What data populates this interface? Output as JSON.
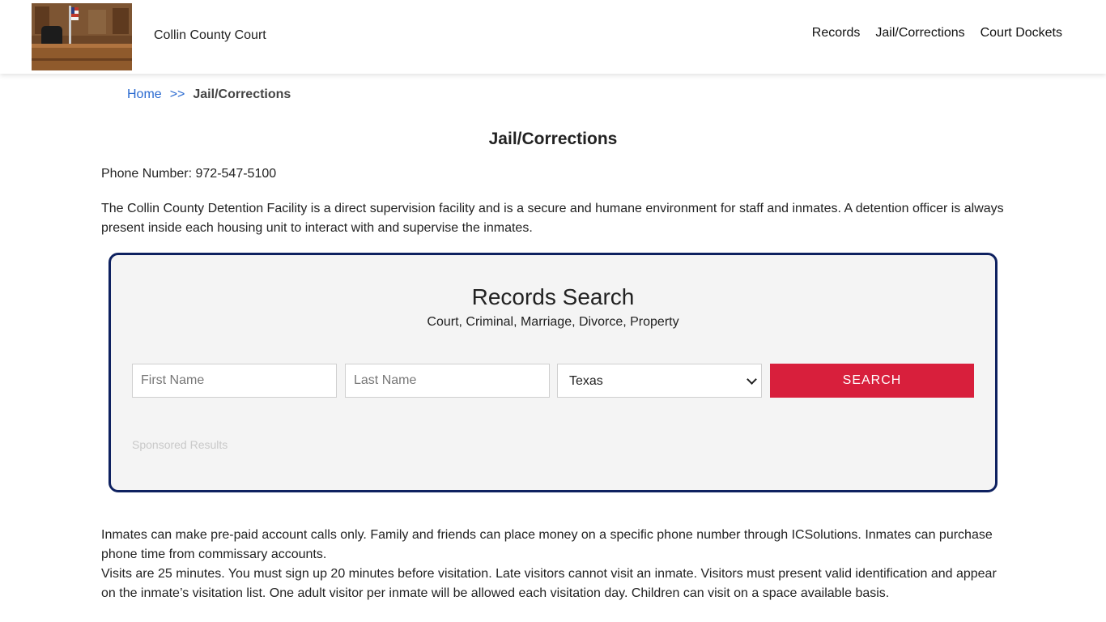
{
  "header": {
    "site_title": "Collin County Court",
    "nav": [
      "Records",
      "Jail/Corrections",
      "Court Dockets"
    ]
  },
  "breadcrumb": {
    "home": "Home",
    "separator": ">>",
    "current": "Jail/Corrections"
  },
  "page": {
    "title": "Jail/Corrections",
    "phone": "Phone Number: 972-547-5100",
    "intro": "The Collin County Detention Facility is a direct supervision facility and is a secure and humane environment for staff and inmates. A detention officer is always present inside each housing unit to interact with and supervise the inmates.",
    "details_1": "Inmates can make pre-paid account calls only. Family and friends can place money on a specific phone number through ICSolutions. Inmates can purchase phone time from commissary accounts.",
    "details_2": "Visits are 25 minutes. You must sign up 20 minutes before visitation. Late visitors cannot visit an inmate. Visitors must present valid identification and appear on the inmate’s visitation list. One adult visitor per inmate will be allowed each visitation day. Children can visit on a space available basis."
  },
  "search": {
    "title": "Records Search",
    "subtitle": "Court, Criminal, Marriage, Divorce, Property",
    "first_name_placeholder": "First Name",
    "last_name_placeholder": "Last Name",
    "state_selected": "Texas",
    "button_label": "SEARCH",
    "sponsored": "Sponsored Results"
  },
  "colors": {
    "accent_red": "#d81f3c",
    "border_navy": "#0e2160",
    "link_blue": "#2a6ad0"
  }
}
